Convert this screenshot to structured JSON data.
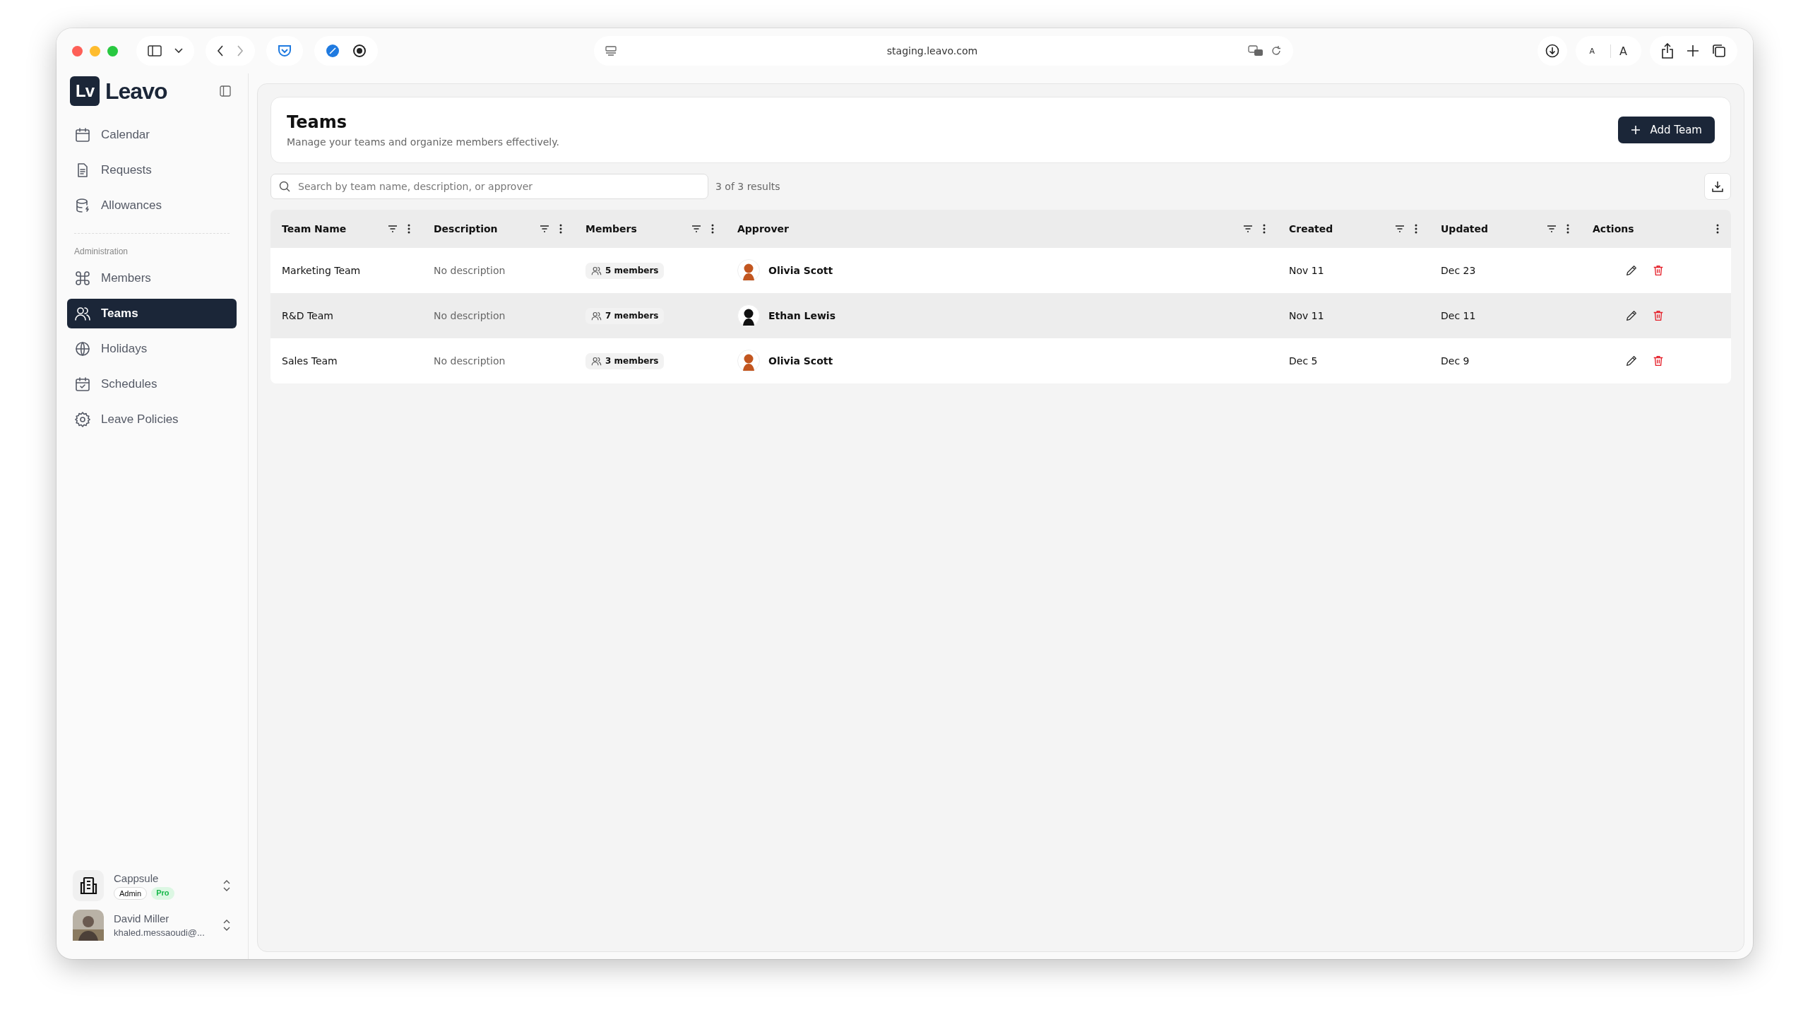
{
  "browser": {
    "url": "staging.leavo.com",
    "text_size_buttons": [
      "A",
      "A"
    ]
  },
  "sidebar": {
    "logo_mark": "Lv",
    "brand": "Leavo",
    "main_items": [
      {
        "label": "Calendar",
        "selected": false
      },
      {
        "label": "Requests",
        "selected": false
      },
      {
        "label": "Allowances",
        "selected": false
      }
    ],
    "section_label": "Administration",
    "admin_items": [
      {
        "label": "Members",
        "selected": false
      },
      {
        "label": "Teams",
        "selected": true
      },
      {
        "label": "Holidays",
        "selected": false
      },
      {
        "label": "Schedules",
        "selected": false
      },
      {
        "label": "Leave Policies",
        "selected": false
      }
    ],
    "workspace": {
      "name": "Cappsule",
      "badges": [
        {
          "label": "Admin",
          "kind": "role"
        },
        {
          "label": "Pro",
          "kind": "plan"
        }
      ]
    },
    "user": {
      "name": "David Miller",
      "email": "khaled.messaoudi@..."
    }
  },
  "page": {
    "title": "Teams",
    "subtitle": "Manage your teams and organize members effectively.",
    "primary_button": "Add Team",
    "search": {
      "placeholder": "Search by team name, description, or approver"
    },
    "result_count": "3 of 3 results"
  },
  "table": {
    "columns": [
      {
        "label": "Team Name",
        "filterable": true
      },
      {
        "label": "Description",
        "filterable": true
      },
      {
        "label": "Members",
        "filterable": true
      },
      {
        "label": "Approver",
        "filterable": true
      },
      {
        "label": "Created",
        "filterable": true
      },
      {
        "label": "Updated",
        "filterable": true
      },
      {
        "label": "Actions",
        "filterable": false
      }
    ],
    "rows": [
      {
        "team": "Marketing Team",
        "description": "No description",
        "members": "5 members",
        "approver": "Olivia Scott",
        "color": "#c2561f",
        "created": "Nov 11",
        "updated": "Dec 23",
        "selected": false
      },
      {
        "team": "R&D Team",
        "description": "No description",
        "members": "7 members",
        "approver": "Ethan Lewis",
        "color": "#111111",
        "created": "Nov 11",
        "updated": "Dec 11",
        "selected": true
      },
      {
        "team": "Sales Team",
        "description": "No description",
        "members": "3 members",
        "approver": "Olivia Scott",
        "color": "#c2561f",
        "created": "Dec 5",
        "updated": "Dec 9",
        "selected": false
      }
    ]
  }
}
